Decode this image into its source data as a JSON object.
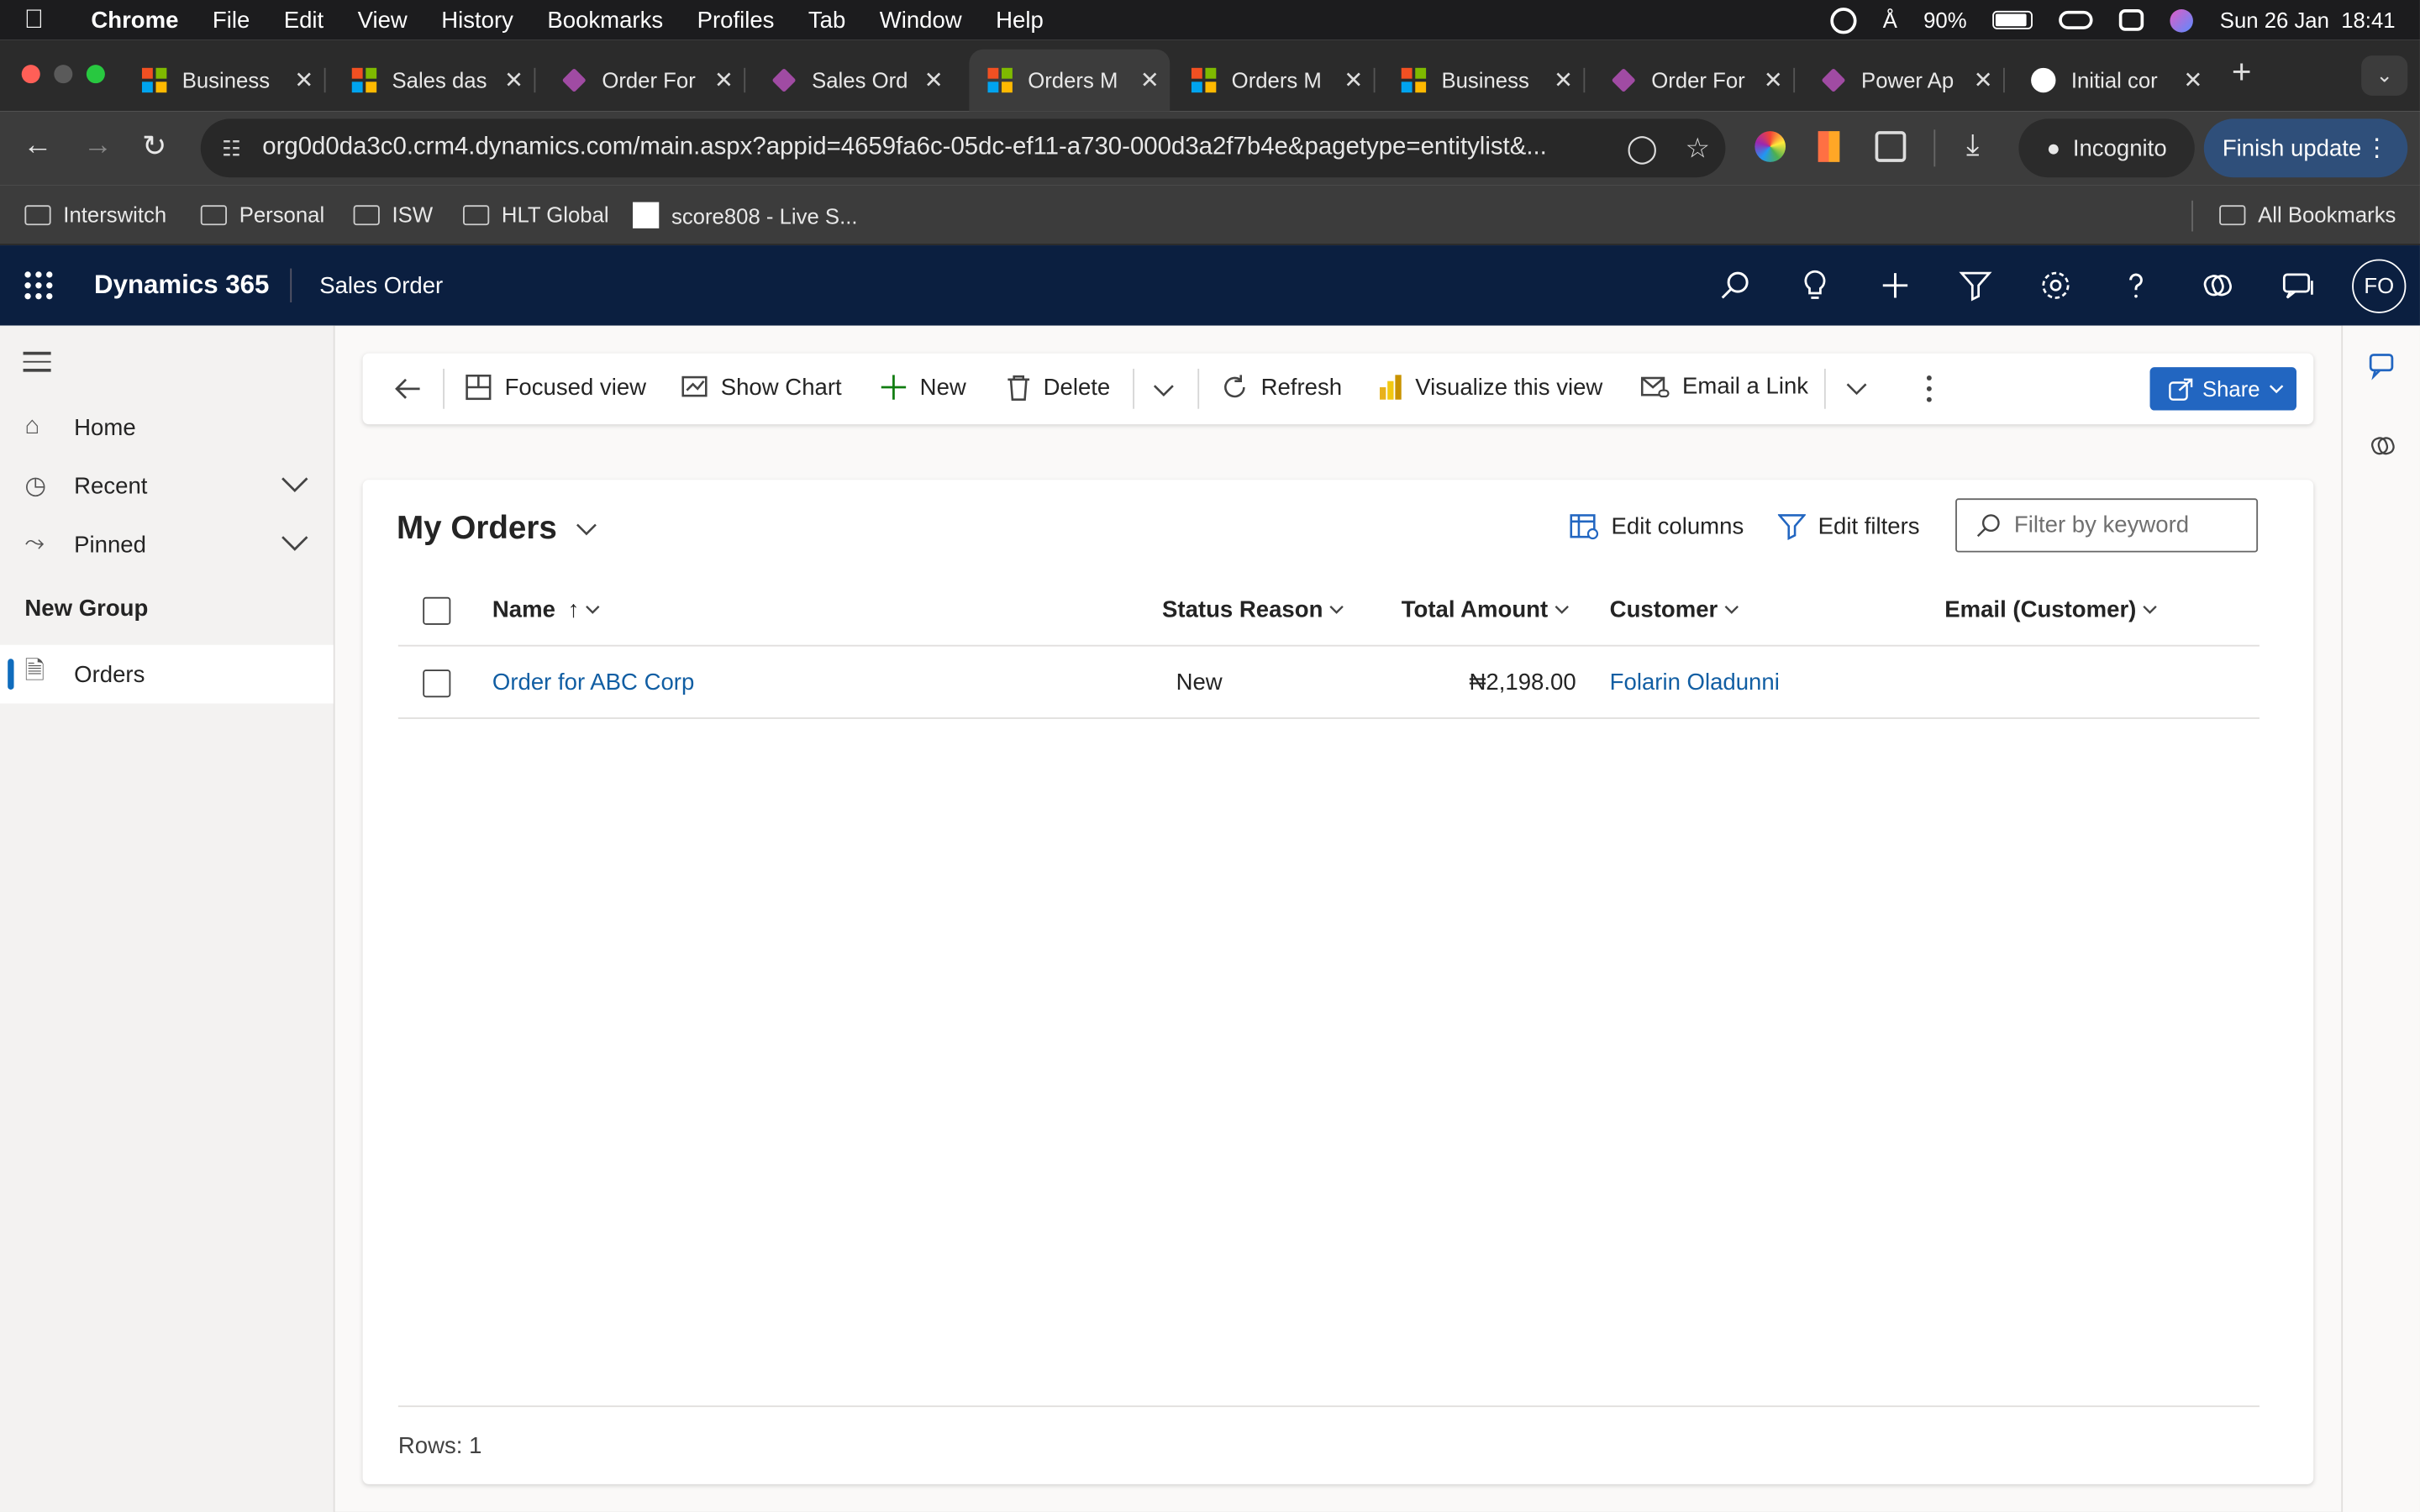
{
  "macmenu": {
    "app": "Chrome",
    "items": [
      "File",
      "Edit",
      "View",
      "History",
      "Bookmarks",
      "Profiles",
      "Tab",
      "Window",
      "Help"
    ],
    "battery": "90%",
    "datetime": "Sun 26 Jan  18:41"
  },
  "tabs": [
    {
      "title": "Business",
      "icon": "microsoft-logo-icon"
    },
    {
      "title": "Sales das",
      "icon": "microsoft-logo-icon"
    },
    {
      "title": "Order For",
      "icon": "power-apps-icon"
    },
    {
      "title": "Sales Ord",
      "icon": "power-apps-icon"
    },
    {
      "title": "Orders M",
      "icon": "microsoft-logo-icon",
      "active": true
    },
    {
      "title": "Orders M",
      "icon": "microsoft-logo-icon"
    },
    {
      "title": "Business",
      "icon": "microsoft-logo-icon"
    },
    {
      "title": "Order For",
      "icon": "power-apps-icon"
    },
    {
      "title": "Power Ap",
      "icon": "power-apps-icon"
    },
    {
      "title": "Initial cor",
      "icon": "github-icon"
    }
  ],
  "browser": {
    "url": "org0d0da3c0.crm4.dynamics.com/main.aspx?appid=4659fa6c-05dc-ef11-a730-000d3a2f7b4e&pagetype=entitylist&...",
    "incognito_label": "Incognito",
    "finish_update_label": "Finish update"
  },
  "bookmarks": {
    "items": [
      "Interswitch",
      "Personal",
      "ISW",
      "HLT Global",
      "score808 - Live S..."
    ],
    "all_label": "All Bookmarks"
  },
  "d365": {
    "brand": "Dynamics 365",
    "app": "Sales Order",
    "user_initials": "FO"
  },
  "sitemap": {
    "home": "Home",
    "recent": "Recent",
    "pinned": "Pinned",
    "group": "New Group",
    "orders": "Orders"
  },
  "commands": {
    "focused_view": "Focused view",
    "show_chart": "Show Chart",
    "new": "New",
    "delete": "Delete",
    "refresh": "Refresh",
    "visualize": "Visualize this view",
    "email_link": "Email a Link",
    "share": "Share"
  },
  "grid": {
    "view_name": "My Orders",
    "edit_columns": "Edit columns",
    "edit_filters": "Edit filters",
    "filter_placeholder": "Filter by keyword",
    "columns": [
      "Name",
      "Status Reason",
      "Total Amount",
      "Customer",
      "Email (Customer)"
    ],
    "rows": [
      {
        "name": "Order for ABC Corp",
        "status": "New",
        "total": "₦2,198.00",
        "customer": "Folarin Oladunni",
        "email": ""
      }
    ],
    "footer": "Rows: 1"
  },
  "colors": {
    "header_bg": "#0b1f40",
    "link": "#115ea3",
    "share_button": "#2266c1"
  }
}
